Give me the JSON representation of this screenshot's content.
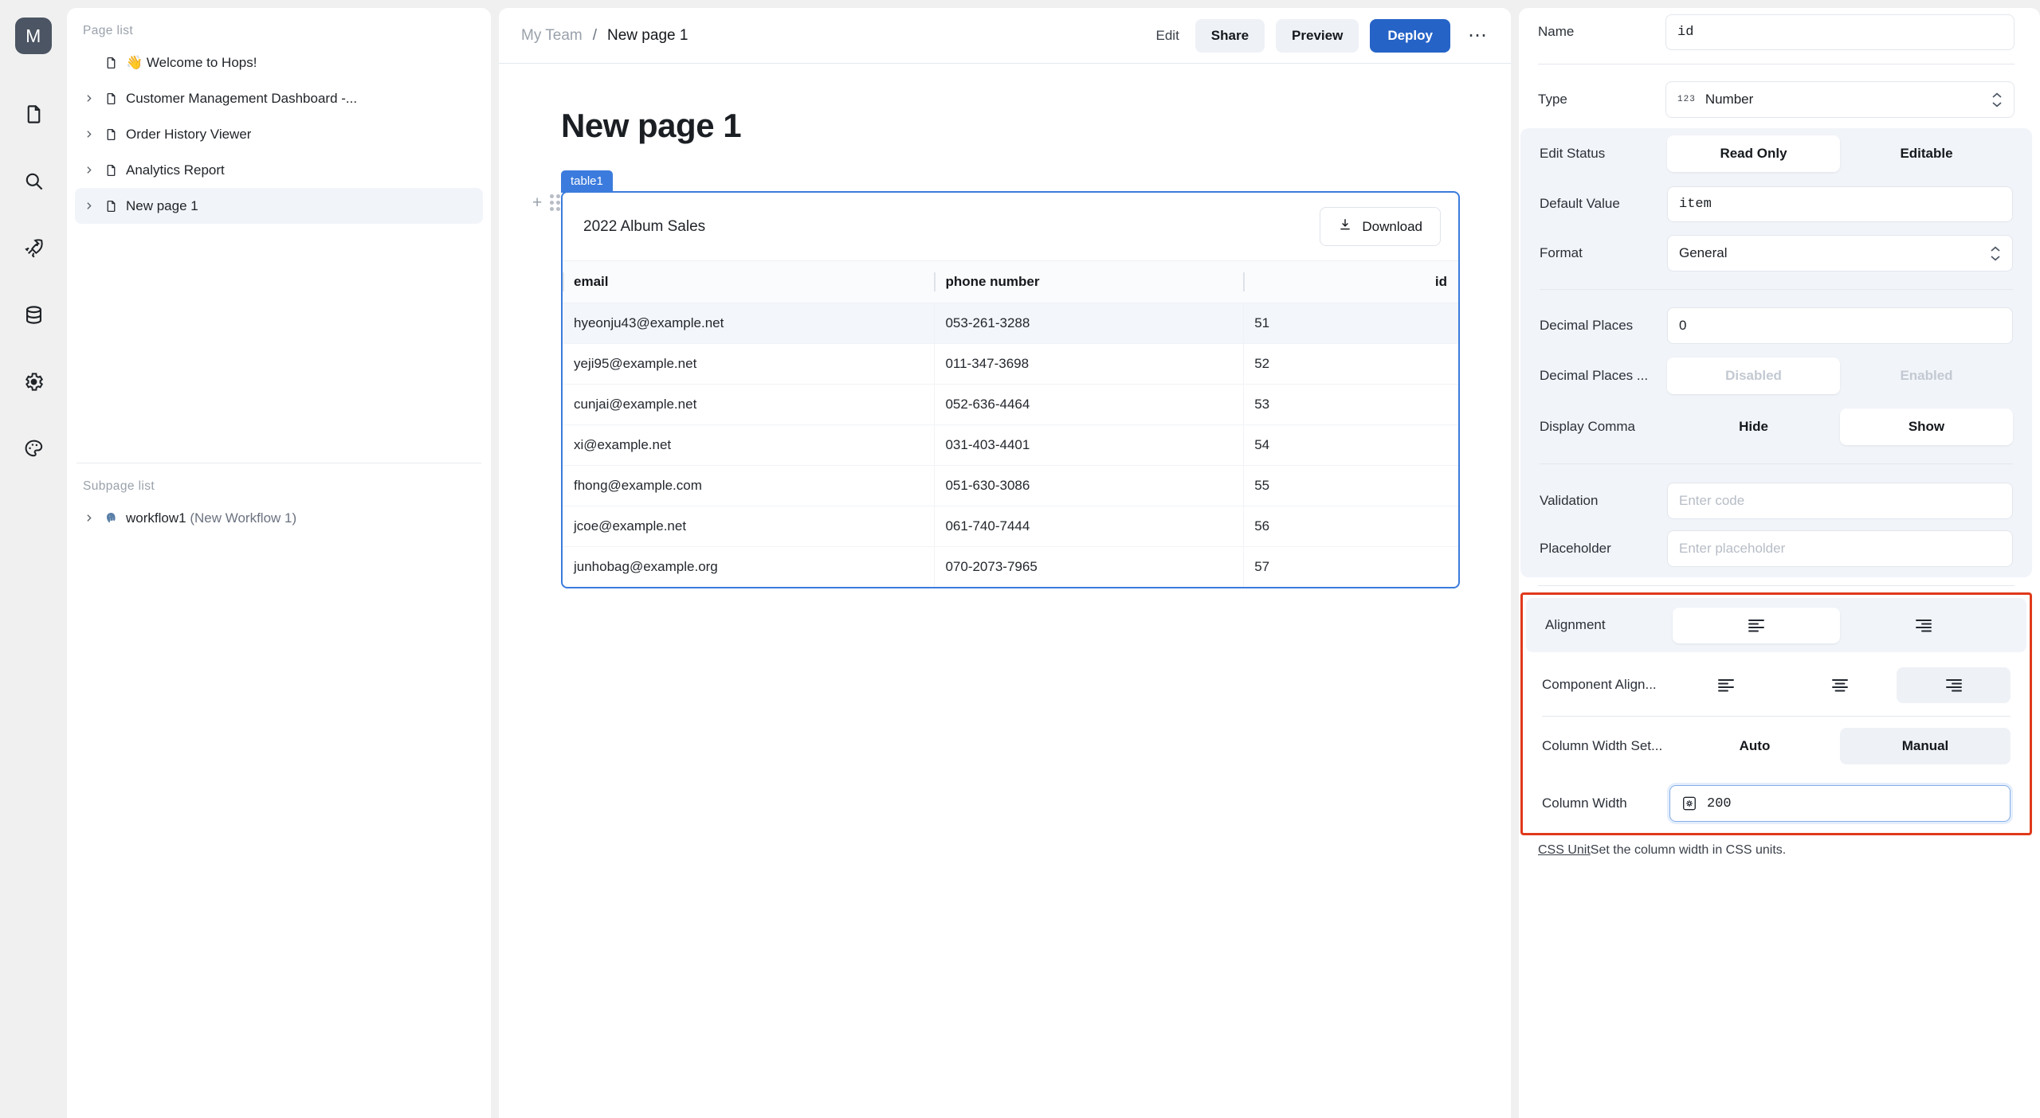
{
  "rail": {
    "avatar_initial": "M",
    "icons": [
      "document-icon",
      "search-icon",
      "rocket-icon",
      "database-icon",
      "gear-icon",
      "palette-icon"
    ]
  },
  "pagelist": {
    "title": "Page list",
    "items": [
      {
        "label": "👋 Welcome to Hops!",
        "expandable": false,
        "active": false
      },
      {
        "label": "Customer Management Dashboard -...",
        "expandable": true,
        "active": false
      },
      {
        "label": "Order History Viewer",
        "expandable": true,
        "active": false
      },
      {
        "label": "Analytics Report",
        "expandable": true,
        "active": false
      },
      {
        "label": "New page 1",
        "expandable": true,
        "active": true
      }
    ],
    "subpage_title": "Subpage list",
    "subpage_items": [
      {
        "name": "workflow1",
        "detail": "(New Workflow 1)",
        "icon": "postgres-elephant-icon"
      }
    ]
  },
  "topbar": {
    "breadcrumb_parent": "My Team",
    "breadcrumb_sep": "/",
    "breadcrumb_current": "New page 1",
    "edit_label": "Edit",
    "share_label": "Share",
    "preview_label": "Preview",
    "deploy_label": "Deploy",
    "more_label": "⋯",
    "accent": "#2563c7"
  },
  "canvas": {
    "page_heading": "New page 1",
    "widget_tag": "table1",
    "table_title": "2022 Album Sales",
    "download_label": "Download",
    "columns": [
      "email",
      "phone number",
      "id"
    ],
    "rows": [
      [
        "hyeonju43@example.net",
        "053-261-3288",
        "51"
      ],
      [
        "yeji95@example.net",
        "011-347-3698",
        "52"
      ],
      [
        "cunjai@example.net",
        "052-636-4464",
        "53"
      ],
      [
        "xi@example.net",
        "031-403-4401",
        "54"
      ],
      [
        "fhong@example.com",
        "051-630-3086",
        "55"
      ],
      [
        "jcoe@example.net",
        "061-740-7444",
        "56"
      ],
      [
        "junhobag@example.org",
        "070-2073-7965",
        "57"
      ]
    ],
    "highlighted_row_index": 0
  },
  "inspector": {
    "name": {
      "label": "Name",
      "value": "id"
    },
    "type": {
      "label": "Type",
      "value": "Number",
      "glyph": "123"
    },
    "edit_status": {
      "label": "Edit Status",
      "options": [
        "Read Only",
        "Editable"
      ],
      "selected": "Read Only"
    },
    "default_value": {
      "label": "Default Value",
      "value": "item"
    },
    "format": {
      "label": "Format",
      "value": "General"
    },
    "decimal_places": {
      "label": "Decimal Places",
      "value": "0"
    },
    "decimal_places_toggle": {
      "label": "Decimal Places ...",
      "options": [
        "Disabled",
        "Enabled"
      ],
      "selected": "Disabled",
      "disabled": true
    },
    "display_comma": {
      "label": "Display Comma",
      "options": [
        "Hide",
        "Show"
      ],
      "selected": "Show"
    },
    "validation": {
      "label": "Validation",
      "placeholder": "Enter code",
      "value": ""
    },
    "placeholder": {
      "label": "Placeholder",
      "placeholder": "Enter placeholder",
      "value": ""
    },
    "alignment": {
      "label": "Alignment",
      "options": [
        "align-left-icon",
        "align-right-icon"
      ],
      "selected_index": 0
    },
    "component_alignment": {
      "label": "Component Align...",
      "options": [
        "align-left-icon",
        "align-center-icon",
        "align-right-icon"
      ],
      "selected_index": 2
    },
    "column_width_setting": {
      "label": "Column Width Set...",
      "options": [
        "Auto",
        "Manual"
      ],
      "selected": "Manual"
    },
    "column_width": {
      "label": "Column Width",
      "value": "200",
      "icon": "css-unit-icon"
    },
    "hint_link": "CSS Unit",
    "hint_text": "Set the column width in CSS units.",
    "highlight_color": "#e0391b"
  }
}
